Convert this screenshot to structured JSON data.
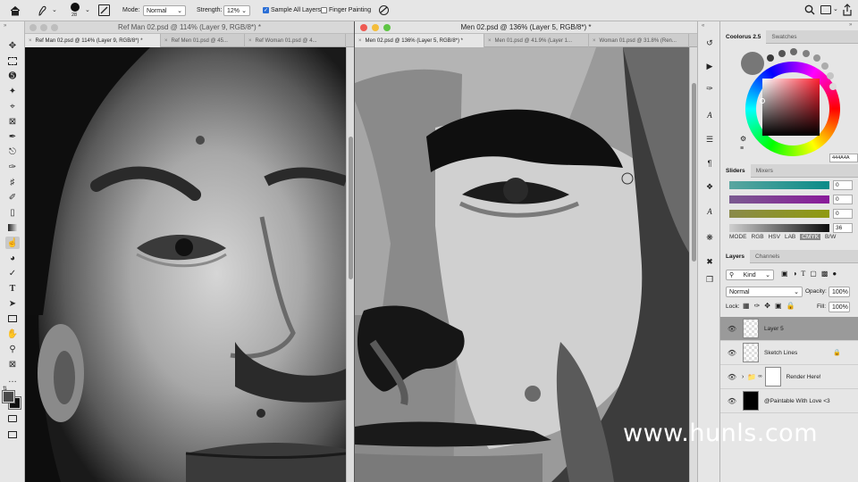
{
  "options_bar": {
    "brush_size": "28",
    "mode_label": "Mode:",
    "mode_value": "Normal",
    "strength_label": "Strength:",
    "strength_value": "12%",
    "sample_all_layers_label": "Sample All Layers",
    "sample_all_layers_checked": true,
    "finger_painting_label": "Finger Painting",
    "finger_painting_checked": false
  },
  "left_doc": {
    "title": "Ref Man 02.psd @ 114% (Layer 9, RGB/8*) *",
    "tabs": [
      {
        "label": "Ref Man 02.psd @ 114% (Layer 9, RGB/8*) *",
        "active": true
      },
      {
        "label": "Ref Men 01.psd @ 45...",
        "active": false
      },
      {
        "label": "Ref Woman 01.psd @ 4...",
        "active": false
      }
    ]
  },
  "right_doc": {
    "title": "Men 02.psd @ 136% (Layer 5, RGB/8*) *",
    "tabs": [
      {
        "label": "Men 02.psd @ 136% (Layer 5, RGB/8*) *",
        "active": true
      },
      {
        "label": "Men 01.psd @ 41.9% (Layer 1...",
        "active": false
      },
      {
        "label": "Woman 01.psd @ 31.8% (Ren...",
        "active": false
      }
    ]
  },
  "color_panel": {
    "tabs": [
      "Coolorus 2.5",
      "Swatches"
    ],
    "hex_value": "444A4A",
    "foreground_color": "#444a4a",
    "swatch_colors": [
      "#3a3a3a",
      "#555555",
      "#6a6a6a",
      "#808080",
      "#969696",
      "#acacac",
      "#c4c4c4",
      "#dcdcdc"
    ]
  },
  "sliders_panel": {
    "tabs": [
      "Sliders",
      "Mixers"
    ],
    "values": [
      "0",
      "0",
      "0",
      "36"
    ],
    "modes": [
      "MODE",
      "RGB",
      "HSV",
      "LAB",
      "CMYK",
      "B/W"
    ],
    "active_mode": "CMYK"
  },
  "layers_panel": {
    "tabs": [
      "Layers",
      "Channels"
    ],
    "filter_label": "Kind",
    "blend_mode": "Normal",
    "opacity_label": "Opacity:",
    "opacity_value": "100%",
    "lock_label": "Lock:",
    "fill_label": "Fill:",
    "fill_value": "100%",
    "layers": [
      {
        "name": "Layer 5",
        "selected": true
      },
      {
        "name": "Sketch Lines",
        "selected": false
      },
      {
        "name": "Render Here!",
        "selected": false
      },
      {
        "name": "@Paintable With Love <3",
        "selected": false
      }
    ]
  },
  "watermark": "www.hunls.com"
}
